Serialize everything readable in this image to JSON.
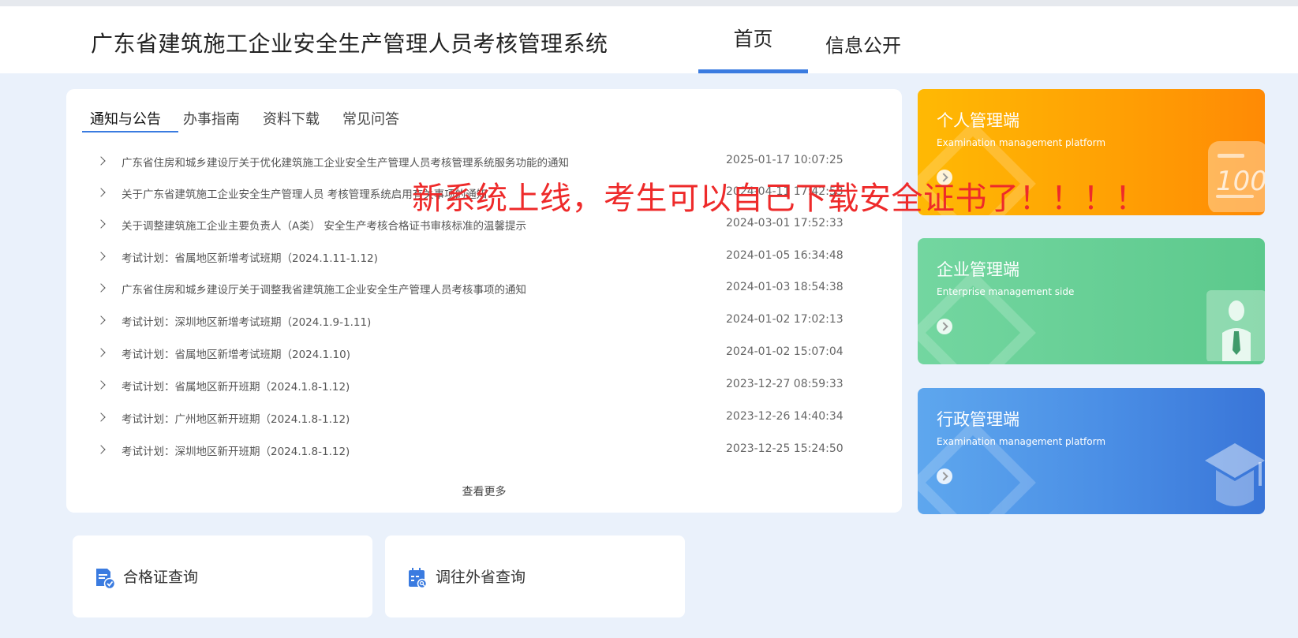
{
  "header": {
    "title": "广东省建筑施工企业安全生产管理人员考核管理系统",
    "nav": [
      "首页",
      "信息公开"
    ]
  },
  "tabs": [
    "通知与公告",
    "办事指南",
    "资料下载",
    "常见问答"
  ],
  "news": [
    {
      "title": "广东省住房和城乡建设厅关于优化建筑施工企业安全生产管理人员考核管理系统服务功能的通知",
      "date": "2025-01-17 10:07:25"
    },
    {
      "title": "关于广东省建筑施工企业安全生产管理人员 考核管理系统启用有关事项的通知",
      "date": "2024-04-11 17:42:53"
    },
    {
      "title": "关于调整建筑施工企业主要负责人（A类） 安全生产考核合格证书审核标准的温馨提示",
      "date": "2024-03-01 17:52:33"
    },
    {
      "title": "考试计划：省属地区新增考试班期（2024.1.11-1.12)",
      "date": "2024-01-05 16:34:48"
    },
    {
      "title": "广东省住房和城乡建设厅关于调整我省建筑施工企业安全生产管理人员考核事项的通知",
      "date": "2024-01-03 18:54:38"
    },
    {
      "title": "考试计划：深圳地区新增考试班期（2024.1.9-1.11)",
      "date": "2024-01-02 17:02:13"
    },
    {
      "title": "考试计划：省属地区新增考试班期（2024.1.10)",
      "date": "2024-01-02 15:07:04"
    },
    {
      "title": "考试计划：省属地区新开班期（2024.1.8-1.12)",
      "date": "2023-12-27 08:59:33"
    },
    {
      "title": "考试计划：广州地区新开班期（2024.1.8-1.12)",
      "date": "2023-12-26 14:40:34"
    },
    {
      "title": "考试计划：深圳地区新开班期（2024.1.8-1.12)",
      "date": "2023-12-25 15:24:50"
    }
  ],
  "more_label": "查看更多",
  "overlay_text": "新系统上线，考生可以自己下载安全证书了！！！！",
  "cards": [
    {
      "title": "个人管理端",
      "subtitle": "Examination management platform",
      "icon": "score-100-icon",
      "color": "#ffa104"
    },
    {
      "title": "企业管理端",
      "subtitle": "Enterprise management side",
      "icon": "person-tie-icon",
      "color": "#5cc98c"
    },
    {
      "title": "行政管理端",
      "subtitle": "Examination management platform",
      "icon": "graduation-cap-icon",
      "color": "#4a8ee5"
    }
  ],
  "quick_links": [
    {
      "label": "合格证查询",
      "icon": "certificate-check-icon"
    },
    {
      "label": "调往外省查询",
      "icon": "calendar-search-icon"
    }
  ],
  "colors": {
    "accent": "#3a7be0",
    "overlay": "#ee2a2a",
    "background": "#eaf1fb"
  }
}
